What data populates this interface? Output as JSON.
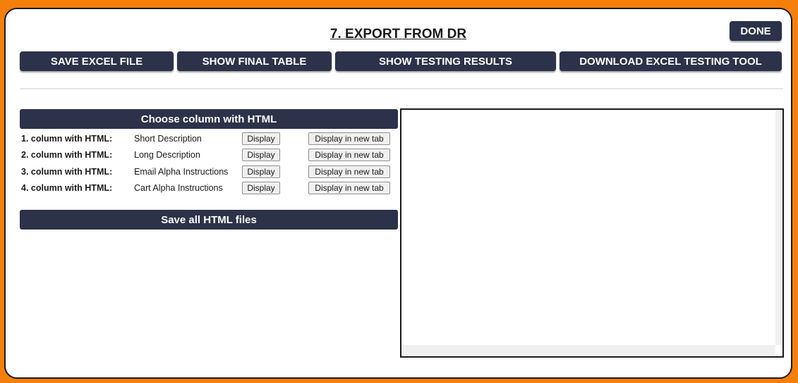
{
  "header": {
    "title": "7. EXPORT FROM DR",
    "done_label": "DONE"
  },
  "toolbar": {
    "save_excel": "SAVE EXCEL FILE",
    "show_final_table": "SHOW FINAL TABLE",
    "show_testing_results": "SHOW TESTING RESULTS",
    "download_testing_tool": "DOWNLOAD EXCEL TESTING TOOL"
  },
  "html_columns": {
    "header": "Choose column with HTML",
    "display_label": "Display",
    "display_new_tab_label": "Display in new tab",
    "rows": [
      {
        "label": "1. column with HTML:",
        "value": "Short Description"
      },
      {
        "label": "2. column with HTML:",
        "value": "Long Description"
      },
      {
        "label": "3. column with HTML:",
        "value": "Email Alpha Instructions"
      },
      {
        "label": "4. column with HTML:",
        "value": "Cart Alpha Instructions"
      }
    ],
    "save_all": "Save all HTML files"
  },
  "colors": {
    "background": "#f57f0b",
    "button": "#2c3249",
    "panel": "#ffffff"
  }
}
